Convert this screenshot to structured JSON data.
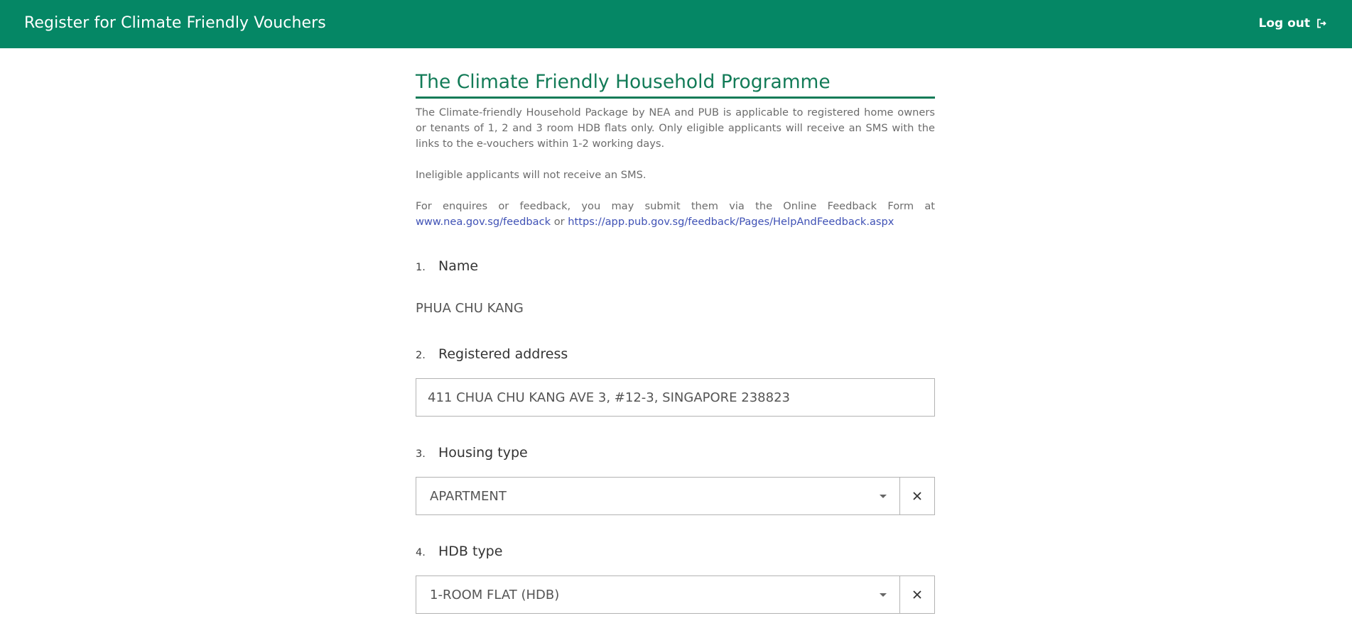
{
  "header": {
    "title": "Register for Climate Friendly Vouchers",
    "logout_label": "Log out",
    "logout_icon": "logout-icon",
    "bg_color": "#058765"
  },
  "intro": {
    "title": "The Climate Friendly Household Programme",
    "p1": "The Climate-friendly Household Package by NEA and PUB is applicable to registered home owners or tenants of 1, 2 and 3 room HDB flats only. Only eligible applicants will receive an SMS with the links to the e-vouchers within 1-2 working days.",
    "p2": "Ineligible applicants will not receive an SMS.",
    "p3_text": "For enquires or feedback, you may submit them via the Online Feedback Form at",
    "link1": "www.nea.gov.sg/feedback",
    "or_text": "or",
    "link2": "https://app.pub.gov.sg/feedback/Pages/HelpAndFeedback.aspx"
  },
  "form": {
    "q1": {
      "num": "1.",
      "label": "Name",
      "value": "PHUA CHU KANG"
    },
    "q2": {
      "num": "2.",
      "label": "Registered address",
      "value": "411 CHUA CHU KANG AVE 3, #12-3, SINGAPORE 238823"
    },
    "q3": {
      "num": "3.",
      "label": "Housing type",
      "value": "APARTMENT"
    },
    "q4": {
      "num": "4.",
      "label": "HDB type",
      "value": "1-ROOM FLAT (HDB)"
    }
  },
  "colors": {
    "accent": "#127b57",
    "link": "#3f51b5"
  }
}
